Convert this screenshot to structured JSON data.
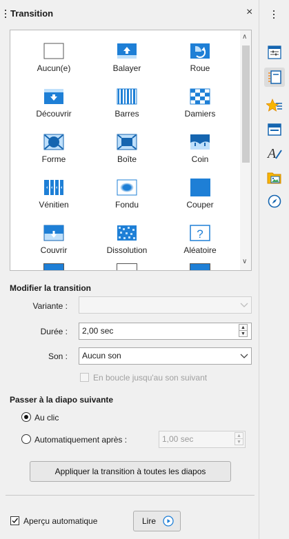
{
  "panel": {
    "title": "Transition",
    "close_glyph": "×"
  },
  "gallery": {
    "items": [
      {
        "label": "Aucun(e)",
        "icon": "none-transition-icon"
      },
      {
        "label": "Balayer",
        "icon": "wipe-transition-icon"
      },
      {
        "label": "Roue",
        "icon": "wheel-transition-icon"
      },
      {
        "label": "Découvrir",
        "icon": "uncover-transition-icon"
      },
      {
        "label": "Barres",
        "icon": "bars-transition-icon"
      },
      {
        "label": "Damiers",
        "icon": "checkers-transition-icon"
      },
      {
        "label": "Forme",
        "icon": "shape-transition-icon"
      },
      {
        "label": "Boîte",
        "icon": "box-transition-icon"
      },
      {
        "label": "Coin",
        "icon": "corner-transition-icon"
      },
      {
        "label": "Vénitien",
        "icon": "venetian-transition-icon"
      },
      {
        "label": "Fondu",
        "icon": "fade-transition-icon"
      },
      {
        "label": "Couper",
        "icon": "cut-transition-icon"
      },
      {
        "label": "Couvrir",
        "icon": "cover-transition-icon"
      },
      {
        "label": "Dissolution",
        "icon": "dissolve-transition-icon"
      },
      {
        "label": "Aléatoire",
        "icon": "random-transition-icon"
      }
    ]
  },
  "modify": {
    "title": "Modifier la transition",
    "variant_label": "Variante :",
    "variant_value": "",
    "duration_label": "Durée :",
    "duration_value": "2,00 sec",
    "sound_label": "Son :",
    "sound_value": "Aucun son",
    "loop_label": "En boucle jusqu'au son suivant"
  },
  "advance": {
    "title": "Passer à la diapo suivante",
    "on_click_label": "Au clic",
    "auto_label": "Automatiquement après :",
    "auto_value": "1,00 sec",
    "apply_all_label": "Appliquer la transition à toutes les diapos"
  },
  "footer": {
    "auto_preview_label": "Aperçu automatique",
    "play_label": "Lire"
  },
  "colors": {
    "accent": "#1e7fd6",
    "accent_dark": "#1565b0"
  },
  "sidebar_tabs": [
    "properties-icon",
    "slide-transition-icon",
    "animation-icon",
    "master-slides-icon",
    "styles-icon",
    "gallery-icon",
    "navigator-icon"
  ]
}
